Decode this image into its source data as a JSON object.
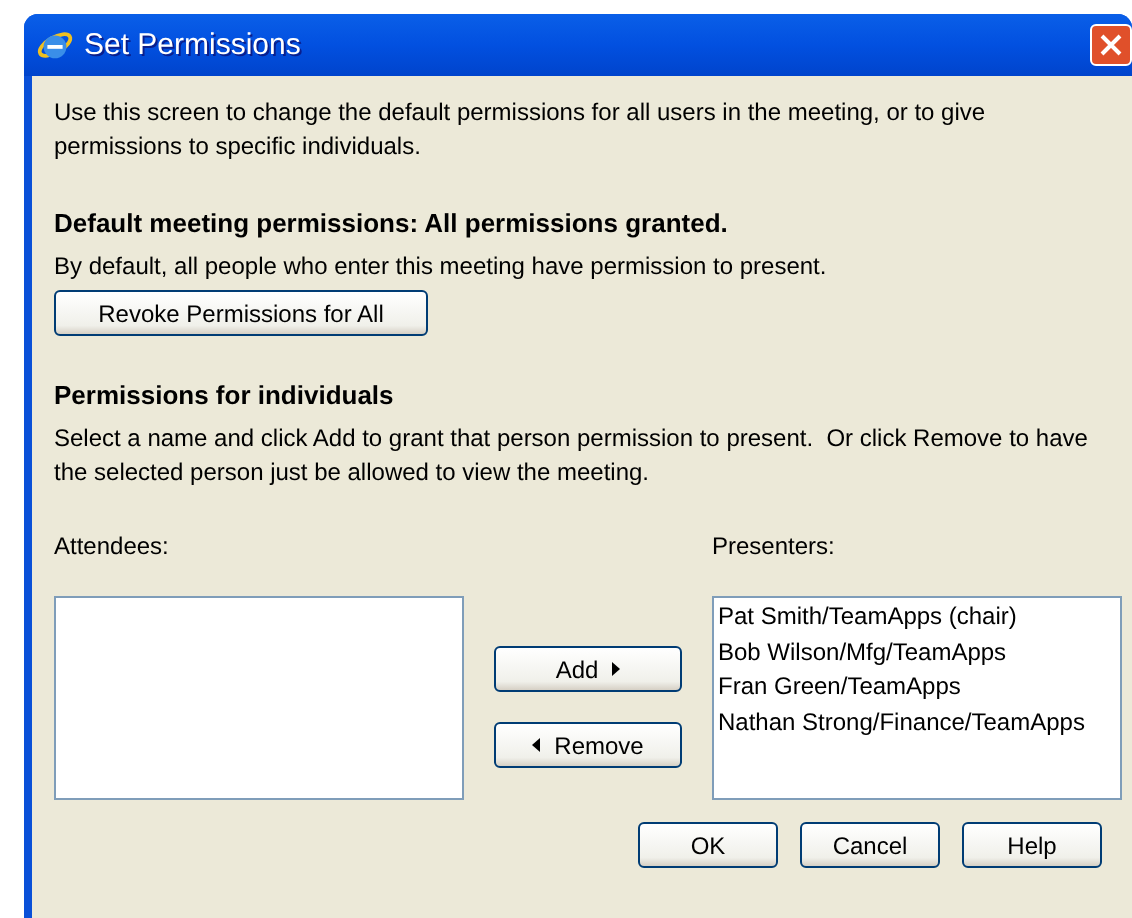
{
  "window": {
    "title": "Set Permissions"
  },
  "intro": "Use this screen to change the default permissions for all users in the meeting, or to give permissions to specific individuals.",
  "default_section": {
    "heading": "Default meeting permissions: All permissions granted.",
    "text": "By default, all people who enter this meeting have permission to present.",
    "button": "Revoke Permissions for All"
  },
  "individuals_section": {
    "heading": "Permissions for individuals",
    "text": "Select a name and click Add to grant that person permission to present.  Or click Remove to have the selected person just be allowed to view the meeting."
  },
  "attendees": {
    "label": "Attendees:"
  },
  "transfer_buttons": [
    {
      "label": "Add",
      "kind": "add"
    },
    {
      "label": "Remove",
      "kind": "remove"
    }
  ],
  "presenters": {
    "label": "Presenters:",
    "items": [
      "Pat Smith/TeamApps (chair)",
      "Bob Wilson/Mfg/TeamApps",
      "Fran Green/TeamApps",
      "Nathan Strong/Finance/TeamApps"
    ]
  },
  "buttons": [
    "OK",
    "Cancel",
    "Help"
  ]
}
